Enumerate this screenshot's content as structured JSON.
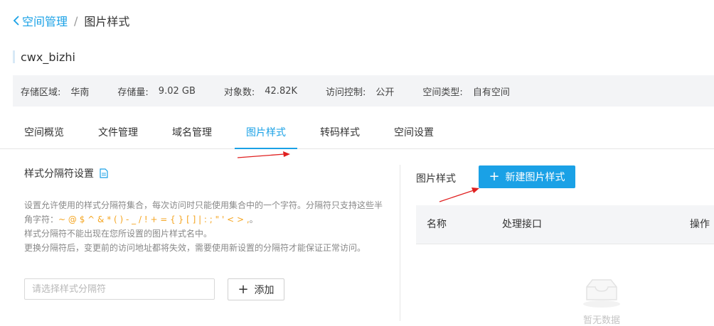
{
  "breadcrumb": {
    "parent": "空间管理",
    "separator": "/",
    "current": "图片样式"
  },
  "bucket": {
    "name": "cwx_bizhi"
  },
  "info": [
    {
      "label": "存储区域:",
      "value": "华南"
    },
    {
      "label": "存储量:",
      "value": "9.02 GB"
    },
    {
      "label": "对象数:",
      "value": "42.82K"
    },
    {
      "label": "访问控制:",
      "value": "公开"
    },
    {
      "label": "空间类型:",
      "value": "自有空间"
    }
  ],
  "tabs": [
    {
      "label": "空间概览"
    },
    {
      "label": "文件管理"
    },
    {
      "label": "域名管理"
    },
    {
      "label": "图片样式",
      "active": true
    },
    {
      "label": "转码样式"
    },
    {
      "label": "空间设置"
    }
  ],
  "separator_section": {
    "title": "样式分隔符设置",
    "desc_line1_a": "设置允许使用的样式分隔符集合，每次访问时只能使用集合中的一个字符。分隔符只支持这些半",
    "desc_line2_a": "角字符：",
    "desc_chars": "~ @ $ ^ & * ( ) - _ / ! + = { } [ ] | : ; \" ' < > ,",
    "desc_line2_b": "。",
    "desc_line3": "样式分隔符不能出现在您所设置的图片样式名中。",
    "desc_line4": "更换分隔符后，变更前的访问地址都将失效，需要使用新设置的分隔符才能保证正常访问。",
    "input_placeholder": "请选择样式分隔符",
    "add_label": "添加"
  },
  "styles_section": {
    "label": "图片样式",
    "new_button": "新建图片样式",
    "columns": [
      "名称",
      "处理接口",
      "操作"
    ],
    "empty_text": "暂无数据"
  },
  "colors": {
    "accent": "#1aa1e6",
    "annotation": "#e02020",
    "highlight_chars": "#f5a623"
  },
  "icons": {
    "back": "chevron-left-icon",
    "doc": "document-icon",
    "empty": "empty-tray-icon"
  }
}
